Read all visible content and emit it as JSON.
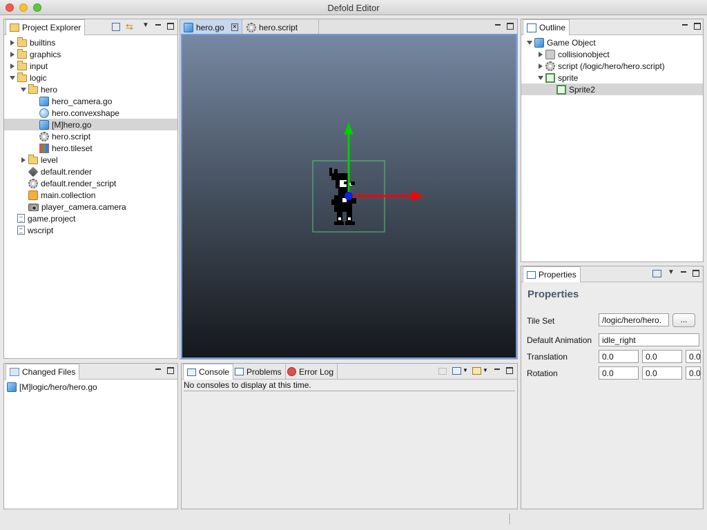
{
  "window": {
    "title": "Defold Editor"
  },
  "project_explorer": {
    "tab_label": "Project Explorer",
    "tree": [
      {
        "label": "builtins",
        "icon": "folder",
        "expander": "collapsed",
        "indent": 0
      },
      {
        "label": "graphics",
        "icon": "folder",
        "expander": "collapsed",
        "indent": 0
      },
      {
        "label": "input",
        "icon": "folder",
        "expander": "collapsed",
        "indent": 0
      },
      {
        "label": "logic",
        "icon": "folder-open",
        "expander": "expanded",
        "indent": 0
      },
      {
        "label": "hero",
        "icon": "folder-open",
        "expander": "expanded",
        "indent": 1
      },
      {
        "label": "hero_camera.go",
        "icon": "game-object",
        "expander": "none",
        "indent": 2
      },
      {
        "label": "hero.convexshape",
        "icon": "convexshape",
        "expander": "none",
        "indent": 2
      },
      {
        "label": "[M]hero.go",
        "icon": "game-object",
        "expander": "none",
        "indent": 2,
        "selected": true
      },
      {
        "label": "hero.script",
        "icon": "script",
        "expander": "none",
        "indent": 2
      },
      {
        "label": "hero.tileset",
        "icon": "tileset",
        "expander": "none",
        "indent": 2
      },
      {
        "label": "level",
        "icon": "folder",
        "expander": "collapsed",
        "indent": 1
      },
      {
        "label": "default.render",
        "icon": "render",
        "expander": "none",
        "indent": 1
      },
      {
        "label": "default.render_script",
        "icon": "script",
        "expander": "none",
        "indent": 1
      },
      {
        "label": "main.collection",
        "icon": "collection",
        "expander": "none",
        "indent": 1
      },
      {
        "label": "player_camera.camera",
        "icon": "camera",
        "expander": "none",
        "indent": 1
      },
      {
        "label": "game.project",
        "icon": "file",
        "expander": "none",
        "indent": 0
      },
      {
        "label": "wscript",
        "icon": "file",
        "expander": "none",
        "indent": 0
      }
    ]
  },
  "editor": {
    "tabs": [
      {
        "label": "hero.go",
        "active": true,
        "icon": "game-object"
      },
      {
        "label": "hero.script",
        "active": false,
        "icon": "script"
      }
    ]
  },
  "outline": {
    "tab_label": "Outline",
    "tree": [
      {
        "label": "Game Object",
        "icon": "game-object",
        "expander": "expanded",
        "indent": 0
      },
      {
        "label": "collisionobject",
        "icon": "collision",
        "expander": "collapsed",
        "indent": 1
      },
      {
        "label": "script (/logic/hero/hero.script)",
        "icon": "script",
        "expander": "collapsed",
        "indent": 1
      },
      {
        "label": "sprite",
        "icon": "sprite",
        "expander": "expanded",
        "indent": 1
      },
      {
        "label": "Sprite2",
        "icon": "sprite",
        "expander": "none",
        "indent": 2,
        "selected": true
      }
    ]
  },
  "properties": {
    "tab_label": "Properties",
    "heading": "Properties",
    "tile_set_label": "Tile Set",
    "tile_set_value": "/logic/hero/hero.",
    "browse_label": "...",
    "default_animation_label": "Default Animation",
    "default_animation_value": "idle_right",
    "translation_label": "Translation",
    "translation": [
      "0.0",
      "0.0",
      "0.0"
    ],
    "rotation_label": "Rotation",
    "rotation": [
      "0.0",
      "0.0",
      "0.0"
    ]
  },
  "changed_files": {
    "tab_label": "Changed Files",
    "items": [
      "[M]logic/hero/hero.go"
    ]
  },
  "console_panel": {
    "tabs": [
      "Console",
      "Problems",
      "Error Log"
    ],
    "message": "No consoles to display at this time."
  },
  "colors": {
    "selection": "#d5d5d5",
    "editor_tab_active": "#c6d7ee",
    "viewport_border": "#6e9be0",
    "gizmo_x": "#ff0000",
    "gizmo_y": "#00cc00",
    "selection_box": "#4fc97a"
  }
}
